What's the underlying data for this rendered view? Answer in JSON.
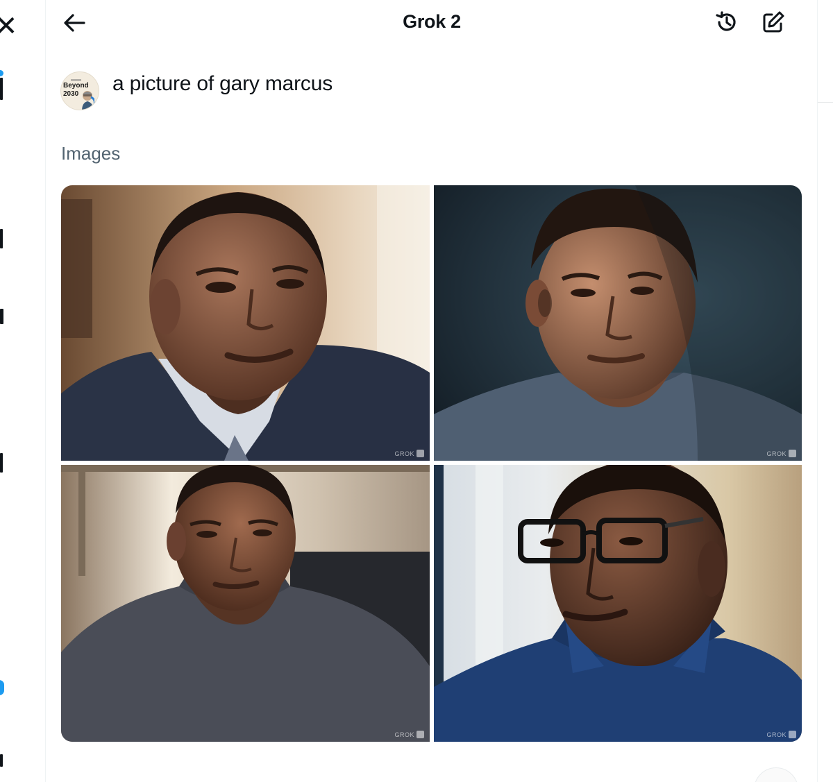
{
  "header": {
    "title": "Grok 2"
  },
  "prompt": {
    "avatar_line1": "Beyond",
    "avatar_line2": "2030",
    "text": "a picture of gary marcus"
  },
  "images_section": {
    "label": "Images",
    "images": [
      {
        "watermark": "GROK"
      },
      {
        "watermark": "GROK"
      },
      {
        "watermark": "GROK"
      },
      {
        "watermark": "GROK"
      }
    ]
  },
  "icons": {
    "back": "arrow-left-icon",
    "history": "history-icon",
    "compose": "compose-icon"
  },
  "colors": {
    "text_primary": "#0f1419",
    "text_secondary": "#536471",
    "accent": "#1d9bf0"
  }
}
